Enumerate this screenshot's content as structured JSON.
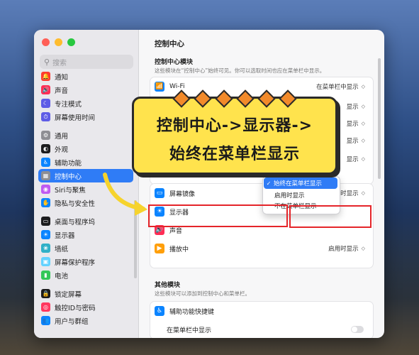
{
  "sidebar": {
    "search_placeholder": "搜索",
    "items": [
      {
        "label": "通知",
        "color": "#ff3b30"
      },
      {
        "label": "声音",
        "color": "#ff2d55"
      },
      {
        "label": "专注模式",
        "color": "#5e5ce6"
      },
      {
        "label": "屏幕使用时间",
        "color": "#5e5ce6"
      },
      {
        "label": "通用",
        "color": "#8e8e93"
      },
      {
        "label": "外观",
        "color": "#1c1c1e"
      },
      {
        "label": "辅助功能",
        "color": "#0a84ff"
      },
      {
        "label": "控制中心",
        "color": "#8e8e93",
        "active": true
      },
      {
        "label": "Siri与聚焦",
        "color": "#bf5af2"
      },
      {
        "label": "隐私与安全性",
        "color": "#0a84ff"
      },
      {
        "label": "桌面与程序坞",
        "color": "#1c1c1e"
      },
      {
        "label": "显示器",
        "color": "#0a84ff"
      },
      {
        "label": "墙纸",
        "color": "#30b0c7"
      },
      {
        "label": "屏幕保护程序",
        "color": "#64d2ff"
      },
      {
        "label": "电池",
        "color": "#34c759"
      },
      {
        "label": "锁定屏幕",
        "color": "#1c1c1e"
      },
      {
        "label": "触控ID与密码",
        "color": "#ff375f"
      },
      {
        "label": "用户与群组",
        "color": "#0a84ff"
      }
    ]
  },
  "main": {
    "title": "控制中心",
    "modules": {
      "heading": "控制中心模块",
      "subtitle": "这些模块在“控制中心”始终可见。你可以选取时间也应在菜单栏中显示。"
    },
    "rows": [
      {
        "label": "Wi-Fi",
        "value": "在菜单栏中显示",
        "color": "#0a84ff"
      },
      {
        "label": "",
        "value": "显示",
        "color": "#0a84ff"
      },
      {
        "label": "",
        "value": "显示",
        "color": "#0a84ff"
      },
      {
        "label": "",
        "value": "显示",
        "color": "#0a84ff"
      },
      {
        "label": "",
        "value": "显示",
        "color": "#0a84ff"
      },
      {
        "label": "屏幕镜像",
        "value": "启用时显示",
        "color": "#0a84ff"
      },
      {
        "label": "显示器",
        "value": "",
        "color": "#0a84ff"
      },
      {
        "label": "声音",
        "value": "",
        "color": "#ff2d55"
      },
      {
        "label": "播放中",
        "value": "启用时显示",
        "color": "#ff9f0a"
      }
    ],
    "dropdown": {
      "selected": "始终在菜单栏显示",
      "options": [
        "启用时显示",
        "不在菜单栏显示"
      ]
    },
    "other": {
      "heading": "其他模块",
      "subtitle": "这些模块可以添加到控制中心和菜单栏。",
      "row_label": "辅助功能快捷键",
      "toggle_label": "在菜单栏中显示"
    }
  },
  "banner": {
    "line1": "控制中心->显示器->",
    "line2": "始终在菜单栏显示"
  }
}
